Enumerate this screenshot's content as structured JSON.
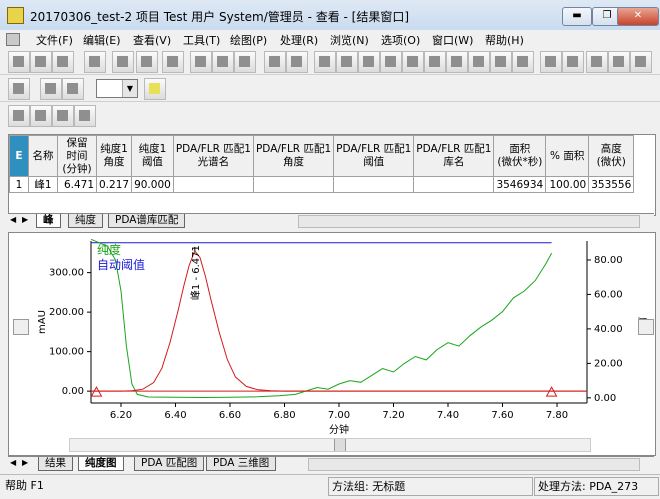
{
  "window": {
    "title": "20170306_test-2 项目 Test 用户 System/管理员 - 查看 - [结果窗口]",
    "min_label": "▬",
    "restore_label": "❐",
    "close_label": "✕"
  },
  "menu": [
    "文件(F)",
    "编辑(E)",
    "查看(V)",
    "工具(T)",
    "绘图(P)",
    "处理(R)",
    "浏览(N)",
    "选项(O)",
    "窗口(W)",
    "帮助(H)"
  ],
  "table": {
    "headers": [
      "名称",
      "保留\n时间\n(分钟)",
      "纯度1\n角度",
      "纯度1\n阈值",
      "PDA/FLR 匹配1\n光谱名",
      "PDA/FLR 匹配1\n角度",
      "PDA/FLR 匹配1\n阈值",
      "PDA/FLR 匹配1\n库名",
      "面积\n(微伏*秒)",
      "% 面积",
      "高度\n(微伏)"
    ],
    "rows": [
      {
        "index": "1",
        "cells": [
          "峰1",
          "6.471",
          "0.217",
          "90.000",
          "",
          "",
          "",
          "",
          "3546934",
          "100.00",
          "353556"
        ]
      }
    ],
    "corner": "E",
    "tabs": [
      "峰",
      "纯度",
      "PDA谱库匹配"
    ]
  },
  "chart_data": {
    "type": "line",
    "series": [
      {
        "name": "纯度",
        "color": "#1aa51a"
      },
      {
        "name": "自动阈值",
        "color": "#1a1ad6"
      }
    ],
    "xlabel": "分钟",
    "ylabel_left": "mAU",
    "ylabel_right": "度",
    "x_ticks": [
      "6.20",
      "6.40",
      "6.60",
      "6.80",
      "7.00",
      "7.20",
      "7.40",
      "7.60",
      "7.80"
    ],
    "y_left_ticks": [
      "0.00",
      "100.00",
      "200.00",
      "300.00"
    ],
    "y_right_ticks": [
      "0.00",
      "20.00",
      "40.00",
      "60.00",
      "80.00"
    ],
    "xlim": [
      6.09,
      7.91
    ],
    "ylim_left": [
      -30,
      380
    ],
    "ylim_right": [
      -3,
      91
    ],
    "peak_label": "峰1 - 6.471",
    "chromatogram_x": [
      6.09,
      6.15,
      6.2,
      6.24,
      6.28,
      6.32,
      6.35,
      6.38,
      6.41,
      6.43,
      6.45,
      6.471,
      6.49,
      6.51,
      6.53,
      6.56,
      6.59,
      6.62,
      6.66,
      6.7,
      6.75,
      6.8,
      6.9,
      7.0,
      7.2,
      7.5,
      7.91
    ],
    "chromatogram_y": [
      0,
      0,
      0,
      1,
      5,
      22,
      58,
      123,
      205,
      265,
      318,
      355,
      338,
      290,
      232,
      150,
      80,
      36,
      12,
      4,
      1,
      0,
      0,
      0,
      0,
      0,
      0
    ],
    "purity_x": [
      6.09,
      6.15,
      6.18,
      6.2,
      6.22,
      6.24,
      6.26,
      6.3,
      6.4,
      6.5,
      6.6,
      6.7,
      6.78,
      6.84,
      6.88,
      6.92,
      6.96,
      7.0,
      7.04,
      7.08,
      7.12,
      7.16,
      7.2,
      7.24,
      7.28,
      7.32,
      7.36,
      7.4,
      7.44,
      7.48,
      7.52,
      7.56,
      7.6,
      7.64,
      7.68,
      7.72,
      7.76,
      7.78
    ],
    "purity_y": [
      92,
      88,
      80,
      62,
      30,
      8,
      2,
      0.5,
      0.3,
      0.2,
      0.3,
      0.6,
      1.2,
      2,
      4,
      6,
      5,
      8,
      10,
      9,
      13,
      17,
      15,
      20,
      24,
      22,
      28,
      32,
      30,
      36,
      41,
      45,
      50,
      58,
      62,
      68,
      78,
      84
    ],
    "threshold": 90,
    "baseline_markers_x": [
      6.11,
      7.78
    ]
  },
  "bottom_tabs": [
    "结果",
    "纯度图",
    "PDA 匹配图",
    "PDA 三维图"
  ],
  "status": {
    "help": "帮助 F1",
    "method_group": "方法组: 无标题",
    "processing": "处理方法: PDA_273"
  }
}
